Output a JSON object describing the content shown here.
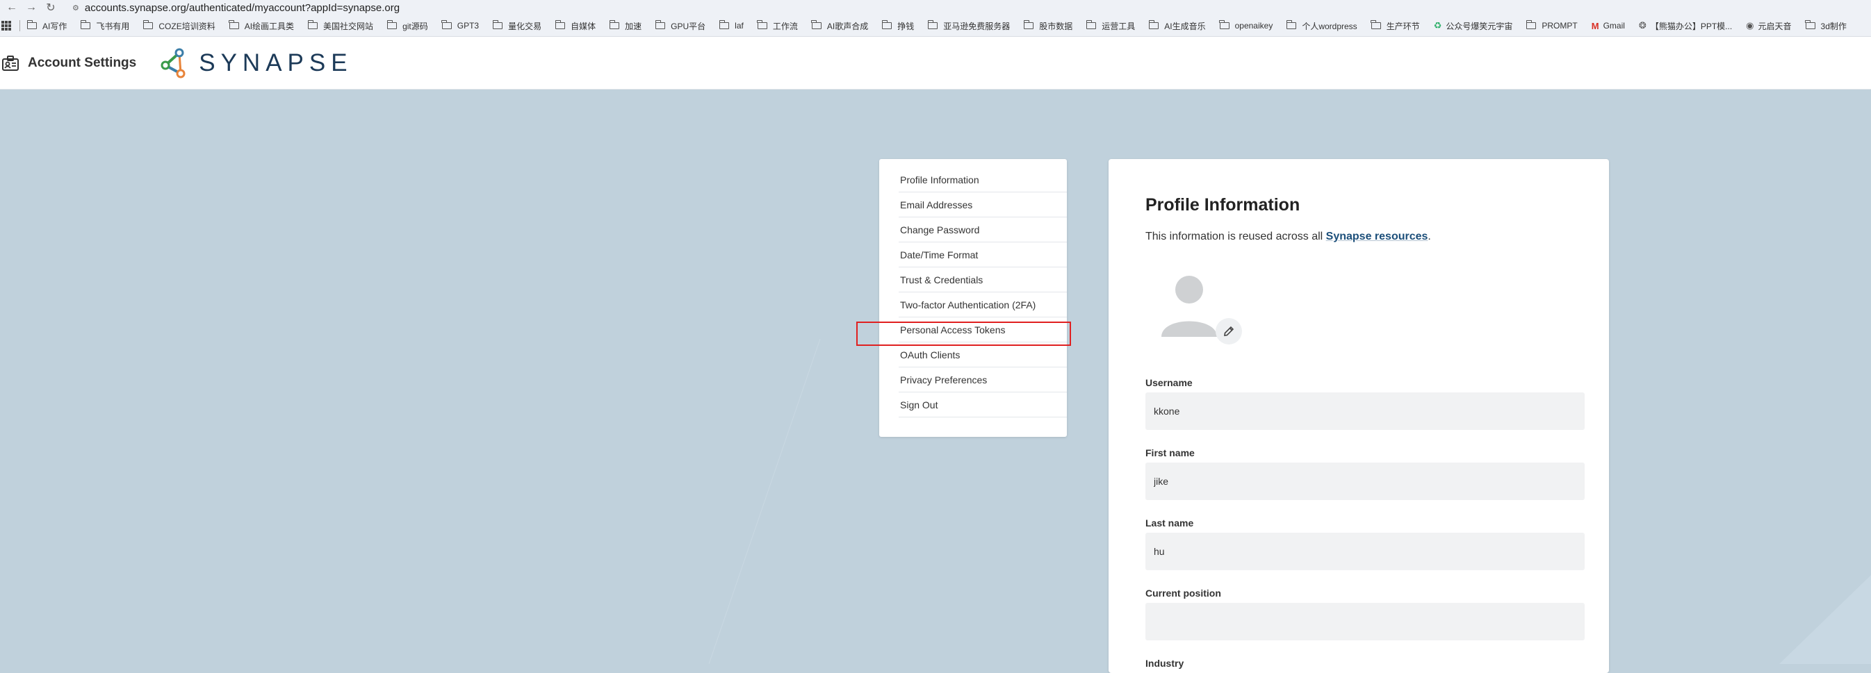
{
  "browser": {
    "url": "accounts.synapse.org/authenticated/myaccount?appId=synapse.org",
    "bookmarks": [
      {
        "label": "AI写作",
        "icon": "folder-icon"
      },
      {
        "label": "飞书有用",
        "icon": "folder-icon"
      },
      {
        "label": "COZE培训资料",
        "icon": "folder-icon"
      },
      {
        "label": "AI绘画工具类",
        "icon": "folder-icon"
      },
      {
        "label": "美国社交网站",
        "icon": "folder-icon"
      },
      {
        "label": "git源码",
        "icon": "folder-icon"
      },
      {
        "label": "GPT3",
        "icon": "folder-icon"
      },
      {
        "label": "量化交易",
        "icon": "folder-icon"
      },
      {
        "label": "自媒体",
        "icon": "folder-icon"
      },
      {
        "label": "加速",
        "icon": "folder-icon"
      },
      {
        "label": "GPU平台",
        "icon": "folder-icon"
      },
      {
        "label": "laf",
        "icon": "folder-icon"
      },
      {
        "label": "工作流",
        "icon": "folder-icon"
      },
      {
        "label": "AI歌声合成",
        "icon": "folder-icon"
      },
      {
        "label": "挣钱",
        "icon": "folder-icon"
      },
      {
        "label": "亚马逊免费服务器",
        "icon": "folder-icon"
      },
      {
        "label": "股市数据",
        "icon": "folder-icon"
      },
      {
        "label": "运营工具",
        "icon": "folder-icon"
      },
      {
        "label": "AI生成音乐",
        "icon": "folder-icon"
      },
      {
        "label": "openaikey",
        "icon": "folder-icon"
      },
      {
        "label": "个人wordpress",
        "icon": "folder-icon"
      },
      {
        "label": "生产环节",
        "icon": "folder-icon"
      },
      {
        "label": "公众号爆笑元宇宙",
        "icon": "wechat-icon"
      },
      {
        "label": "PROMPT",
        "icon": "folder-icon"
      },
      {
        "label": "Gmail",
        "icon": "gmail-icon"
      },
      {
        "label": "【熊猫办公】PPT模...",
        "icon": "panda-icon"
      },
      {
        "label": "元启天音",
        "icon": "globe-icon"
      },
      {
        "label": "3d制作",
        "icon": "folder-icon"
      }
    ]
  },
  "header": {
    "title": "Account Settings",
    "logo_text": "SYNAPSE",
    "colors": {
      "logo_text": "#1c3a58",
      "logo_green": "#3a9a4a",
      "logo_orange": "#e8843a",
      "logo_blue": "#3c7ea8"
    }
  },
  "menu": {
    "items": [
      "Profile Information",
      "Email Addresses",
      "Change Password",
      "Date/Time Format",
      "Trust & Credentials",
      "Two-factor Authentication (2FA)",
      "Personal Access Tokens",
      "OAuth Clients",
      "Privacy Preferences",
      "Sign Out"
    ],
    "highlighted": "Personal Access Tokens",
    "highlight_color": "#e02020"
  },
  "profile": {
    "heading": "Profile Information",
    "intro_prefix": "This information is reused across all ",
    "intro_link": "Synapse resources",
    "intro_suffix": ".",
    "fields": {
      "username": {
        "label": "Username",
        "value": "kkone"
      },
      "first_name": {
        "label": "First name",
        "value": "jike"
      },
      "last_name": {
        "label": "Last name",
        "value": "hu"
      },
      "current_position": {
        "label": "Current position",
        "value": ""
      },
      "industry": {
        "label": "Industry"
      }
    }
  }
}
